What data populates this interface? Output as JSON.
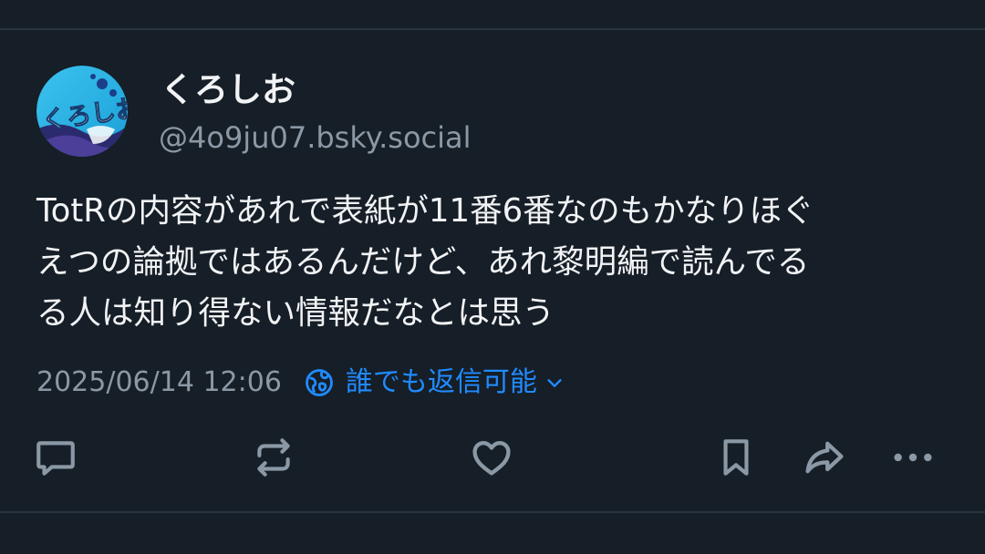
{
  "post": {
    "author": {
      "display_name": "くろしお",
      "handle": "@4o9ju07.bsky.social",
      "avatar_text": "くろしお"
    },
    "text": "TotRの内容があれで表紙が11番6番なのもかなりほぐ\nえつの論拠ではあるんだけど、あれ黎明編で読んでる\nる人は知り得ない情報だなとは思う",
    "timestamp": "2025/06/14 12:06",
    "reply_setting": "誰でも返信可能"
  },
  "actions": [
    {
      "name": "reply",
      "icon": "speech-bubble-icon"
    },
    {
      "name": "repost",
      "icon": "repost-icon"
    },
    {
      "name": "like",
      "icon": "heart-icon"
    },
    {
      "name": "bookmark",
      "icon": "bookmark-icon"
    },
    {
      "name": "share",
      "icon": "share-arrow-icon"
    },
    {
      "name": "more",
      "icon": "more-dots-icon"
    }
  ],
  "colors": {
    "background": "#161e27",
    "text": "#f1f3f5",
    "muted": "#8b98a5",
    "accent": "#208bfe",
    "divider": "#2a3441"
  }
}
